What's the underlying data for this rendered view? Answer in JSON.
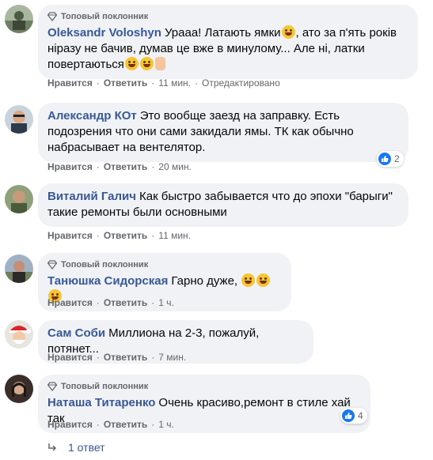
{
  "badge_label": "Топовый поклонник",
  "action_like": "Нравится",
  "action_reply": "Ответить",
  "comments": [
    {
      "author": "Oleksandr Voloshyn",
      "text_part1": "Урааа! Латають ямки",
      "text_part2": ", ато за п'ять років ніразу не бачив, думав це вже в минулому... Але ні, латки повертаються",
      "time": "11 мин.",
      "edited": "Отредактировано"
    },
    {
      "author": "Александр КОт",
      "text": "Это вообще заезд на заправку. Есть подозрения что они сами закидали ямы. ТК как обычно набрасывает на вентелятор.",
      "time": "20 мин.",
      "reactions": "2"
    },
    {
      "author": "Виталий Галич",
      "text": "Как быстро забывается что до эпохи \"барыги\" такие ремонты были основными",
      "time": "11 мин."
    },
    {
      "author": "Танюшка Сидорская",
      "text": "Гарно дуже,",
      "time": "1 ч."
    },
    {
      "author": "Сам Соби",
      "text": "Миллиона на 2-3, пожалуй, потянет...",
      "time": "7 мин."
    },
    {
      "author": "Наташа Титаренко",
      "text": "Очень красиво,ремонт в стиле хай так",
      "time": "1 ч.",
      "reactions": "4"
    }
  ],
  "replies_label": "1 ответ",
  "colors": {
    "author": "#385898",
    "bubble": "#f0f2f5",
    "meta": "#65676b",
    "like": "#1877f2"
  }
}
